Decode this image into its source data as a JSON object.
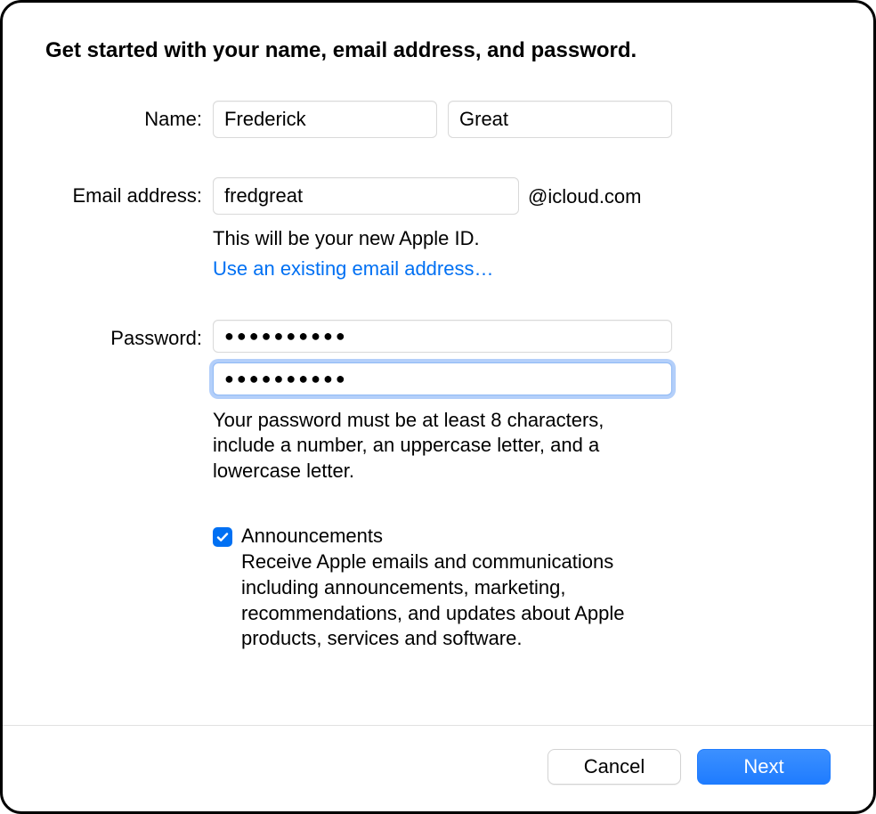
{
  "heading": "Get started with your name, email address, and password.",
  "labels": {
    "name": "Name:",
    "email": "Email address:",
    "password": "Password:"
  },
  "fields": {
    "first_name": "Frederick",
    "last_name": "Great",
    "email_username": "fredgreat",
    "email_suffix": "@icloud.com",
    "password_value": "●●●●●●●●●●",
    "password_confirm_value": "●●●●●●●●●●"
  },
  "helpers": {
    "apple_id_note": "This will be your new Apple ID.",
    "use_existing_link": "Use an existing email address…",
    "password_hint": "Your password must be at least 8 characters, include a number, an uppercase letter, and a lowercase letter."
  },
  "announcements": {
    "checked": true,
    "title": "Announcements",
    "description": "Receive Apple emails and communications including announcements, marketing, recommendations, and updates about Apple products, services and software."
  },
  "buttons": {
    "cancel": "Cancel",
    "next": "Next"
  }
}
